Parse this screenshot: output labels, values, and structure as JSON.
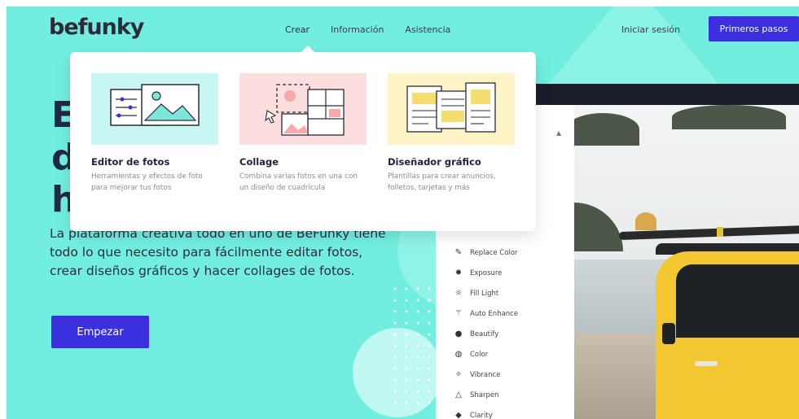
{
  "brand": {
    "logo_text": "befunky",
    "accent_color": "#3b2fe0",
    "background_color": "#72eee0"
  },
  "nav": {
    "items": [
      {
        "label": "Crear"
      },
      {
        "label": "Información"
      },
      {
        "label": "Asistencia"
      }
    ],
    "login_label": "Iniciar sesión",
    "cta_label": "Primeros pasos"
  },
  "hero": {
    "title_partial": [
      "E",
      "d",
      "h"
    ],
    "description": "La plataforma creativa todo en uno de BeFunky tiene todo lo que necesito para fácilmente editar fotos, crear diseños gráficos y hacer collages de fotos.",
    "start_button": "Empezar"
  },
  "dropdown": {
    "cards": [
      {
        "title": "Editor de fotos",
        "description": "Herramientas y efectos de foto para mejorar tus fotos",
        "icon": "photo-editor-illustration"
      },
      {
        "title": "Collage",
        "description": "Combina varias fotos en una con un diseño de cuadrícula",
        "icon": "collage-illustration"
      },
      {
        "title": "Diseñador gráfico",
        "description": "Plantillas para crear anuncios, folletos, tarjetas y más",
        "icon": "graphic-designer-illustration"
      }
    ]
  },
  "editor_menu": {
    "items": [
      {
        "label": "Replace Color",
        "icon": "dropper-icon"
      },
      {
        "label": "Exposure",
        "icon": "sun-icon"
      },
      {
        "label": "Fill Light",
        "icon": "bulb-icon"
      },
      {
        "label": "Auto Enhance",
        "icon": "wand-icon"
      },
      {
        "label": "Beautify",
        "icon": "dot-icon"
      },
      {
        "label": "Color",
        "icon": "color-icon"
      },
      {
        "label": "Vibrance",
        "icon": "vibrance-icon"
      },
      {
        "label": "Sharpen",
        "icon": "triangle-icon"
      },
      {
        "label": "Clarity",
        "icon": "diamond-icon"
      }
    ]
  }
}
